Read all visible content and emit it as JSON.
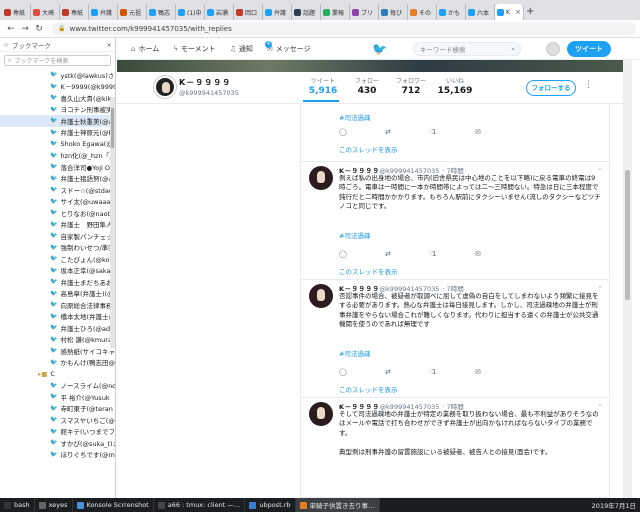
{
  "browser": {
    "tabs": [
      {
        "label": "専紙",
        "color": "#c0392b"
      },
      {
        "label": "大崎",
        "color": "#e74c3c"
      },
      {
        "label": "専紙",
        "color": "#c0392b"
      },
      {
        "label": "弁護",
        "color": "#1da1f2"
      },
      {
        "label": "元祖",
        "color": "#d35400"
      },
      {
        "label": "鴨志",
        "color": "#1da1f2"
      },
      {
        "label": "(1)中",
        "color": "#1da1f2"
      },
      {
        "label": "岩瀬",
        "color": "#1da1f2"
      },
      {
        "label": "岡口",
        "color": "#c0392b"
      },
      {
        "label": "弁護",
        "color": "#1da1f2"
      },
      {
        "label": "話題",
        "color": "#2c3e50"
      },
      {
        "label": "業報",
        "color": "#27ae60"
      },
      {
        "label": "ブリ",
        "color": "#8e44ad"
      },
      {
        "label": "毎び",
        "color": "#2980b9"
      },
      {
        "label": "その",
        "color": "#e67e22"
      },
      {
        "label": "かも",
        "color": "#1da1f2"
      },
      {
        "label": "六本",
        "color": "#1da1f2"
      },
      {
        "label": "K",
        "color": "#1da1f2",
        "active": true
      }
    ],
    "new_tab": "+",
    "url": "www.twitter.com/k999941457035/with_replies"
  },
  "sidebar": {
    "title": "ブックマーク",
    "search_placeholder": "ブックマークを検索",
    "items": [
      {
        "label": "ystk(@lawkus)さん"
      },
      {
        "label": "K－9999(@k99994"
      },
      {
        "label": "喜久山大貴(@kiku"
      },
      {
        "label": "ヨコチン刑事被実"
      },
      {
        "label": "弁護士秋重美(@a",
        "selected": true
      },
      {
        "label": "弁護士神原元(@k"
      },
      {
        "label": "Shoko Egawa(@a"
      },
      {
        "label": "hzn化(@_hzn「」3"
      },
      {
        "label": "落合洋司●Yoji O"
      },
      {
        "label": "弁護士猪語努(@a"
      },
      {
        "label": "スドー☆(@stdau"
      },
      {
        "label": "サイ太(@uwaaaa)"
      },
      {
        "label": "とりなお(@naotar"
      },
      {
        "label": "弁護士　野田隼人"
      },
      {
        "label": "自家製パンチェック"
      },
      {
        "label": "強制わいせつ/準強"
      },
      {
        "label": "こたぴょん(@kotar"
      },
      {
        "label": "坂本正幸(@sakar"
      },
      {
        "label": "弁護士まだちあおま"
      },
      {
        "label": "高島章(弁護士)(@"
      },
      {
        "label": "向原総合法律事務"
      },
      {
        "label": "橋本太地(弁護士@"
      },
      {
        "label": "弁護士ひろ(@adv"
      },
      {
        "label": "村松 謙(@kmurar"
      },
      {
        "label": "感熱紙(サイコキャ"
      },
      {
        "label": "かもんけ(鴨志田@"
      },
      {
        "label": "C",
        "folder": true
      },
      {
        "label": "ノースライム(@no"
      },
      {
        "label": "平 裕介(@Yusuk"
      },
      {
        "label": "寺町東子(@teran"
      },
      {
        "label": "スマスヤいちご(@"
      },
      {
        "label": "館キテ(いつまでフ"
      },
      {
        "label": "すかぴ(@suka_t)さ"
      },
      {
        "label": "ほりぐちです(@m"
      }
    ]
  },
  "twitter": {
    "nav": {
      "home": "ホーム",
      "moments": "モーメント",
      "notifications": "通知",
      "messages": "メッセージ",
      "notif_count": "4"
    },
    "search_placeholder": "キーワード検索",
    "tweet_button": "ツイート",
    "profile": {
      "name": "K－９９９９",
      "handle": "@k999941457035",
      "stats": [
        {
          "label": "ツイート",
          "value": "5,916",
          "active": true
        },
        {
          "label": "フォロー",
          "value": "430"
        },
        {
          "label": "フォロワー",
          "value": "712"
        },
        {
          "label": "いいね",
          "value": "15,169"
        }
      ],
      "follow_button": "フォローする"
    },
    "tweets": [
      {
        "partial": true,
        "hashtag": "#司法過疎",
        "replies": "",
        "retweets": "",
        "likes": "1",
        "thread_link": "このスレッドを表示"
      },
      {
        "name": "K－９９９９",
        "handle": "@k999941457035",
        "time": "· 7時間",
        "text": "例えば私の出身地の場合、市内(旧舎県民は中心地のことを以下略)に戻る電車の終電は9時ごろ。電車は一時間に一本か時間帯によっては二〜三時間ない。特急は日に三本程度で鈍行だと二時間かかかります。もちろん駅前にタクシーいません(流しのタクシーなどツチノコと同じです。",
        "hashtag": "#司法過疎",
        "replies": "",
        "retweets": "",
        "likes": "1",
        "thread_link": "このスレッドを表示"
      },
      {
        "name": "K－９９９９",
        "handle": "@k999941457035",
        "time": "· 7時間",
        "text": "否認事件の場合、被疑者が取調べに屈して虚偽の自白をしてしまわないよう頻繁に接見をする必要があります。熱心な弁護士は毎日接見します。しかし、司法過疎地の弁護士が刑事弁護をやらない場合これが難しくなります。代わりに担当する遠くの弁護士が公共交通機関を使うのであれば無理です",
        "hashtag": "#司法過疎",
        "replies": "",
        "retweets": "",
        "likes": "1",
        "thread_link": "このスレッドを表示"
      },
      {
        "name": "K－９９９９",
        "handle": "@k999941457035",
        "time": "· 7時間",
        "text": "そして司法過疎地の弁護士が特定の業務を取り扱わない場合、最も不利益がありそうなのはメールや電話で打ち合わせができず弁護士が出向かなければならないタイプの業務です。\n\n典型例は刑事弁護の留置施設にいる被疑者、被告人との接見(面会)です。"
      }
    ]
  },
  "taskbar": {
    "items": [
      {
        "label": "bash",
        "color": "#333"
      },
      {
        "label": "xeyes",
        "color": "#666"
      },
      {
        "label": "Konsole Scrrenshot",
        "color": "#4a90d9"
      },
      {
        "label": "a66 : tmux: client —…",
        "color": "#444"
      },
      {
        "label": "ubpost.rb",
        "color": "#3b7dd8"
      },
      {
        "label": "単騎子供置き去り事…",
        "color": "#e67e22",
        "active": true
      }
    ],
    "clock": "2019年7月1日"
  }
}
